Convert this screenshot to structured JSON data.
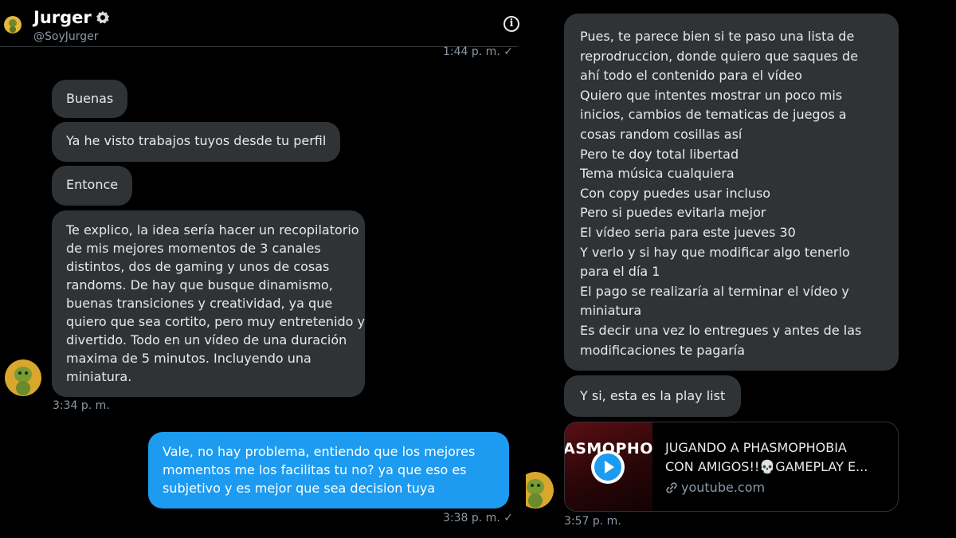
{
  "header": {
    "name": "Jurger",
    "handle": "@SoyJurger",
    "first_stamp": "1:44 p. m.",
    "verified_icon": "verified-badge-icon",
    "info_icon": "info-icon"
  },
  "left_messages": [
    "Buenas",
    "Ya he visto trabajos tuyos desde tu perfil",
    "Entonce"
  ],
  "long_message": [
    "Te explico, la idea sería hacer un recopilatorio",
    "de mis mejores momentos de 3 canales",
    "distintos, dos de gaming y unos de cosas",
    "randoms. De hay que busque dinamismo,",
    "buenas transiciones y creatividad, ya que",
    "quiero que sea cortito, pero muy entretenido y",
    "divertido. Todo en un vídeo de una duración",
    "maxima de 5 minutos. Incluyendo una",
    "miniatura."
  ],
  "incoming_stamp": "3:34 p. m.",
  "outgoing_message": [
    "Vale, no hay problema, entiendo que los mejores",
    "momentos me los facilitas tu no? ya que eso es",
    "subjetivo y es mejor que sea decision tuya"
  ],
  "outgoing_stamp": "3:38 p. m.",
  "check_mark": "✓",
  "right_message": [
    "Pues, te parece bien si te paso una lista de",
    "reprodruccion, donde quiero que saques de",
    "ahí todo el contenido para el vídeo",
    "Quiero que intentes mostrar un poco mis",
    "inicios, cambios de tematicas de juegos a",
    "cosas random cosillas así",
    "Pero te doy total libertad",
    "Tema música cualquiera",
    "Con copy puedes usar incluso",
    "Pero si puedes evitarla mejor",
    "El vídeo seria para este jueves 30",
    "Y verlo y si hay que modificar algo tenerlo",
    "para el día 1",
    "El pago se realizaría al terminar el vídeo y",
    "miniatura",
    "Es decir una vez lo entregues y antes de las",
    "modificaciones te pagaría"
  ],
  "playlist_message": "Y si, esta es la play list",
  "link_card": {
    "thumb_text": "ASMOPHO",
    "title": [
      "JUGANDO A PHASMOPHOBIA",
      "CON AMIGOS!!💀GAMEPLAY E..."
    ],
    "domain": "youtube.com",
    "play_icon": "play-icon",
    "link_icon": "link-icon"
  },
  "right_stamp": "3:57 p. m.",
  "colors": {
    "background": "#000000",
    "incoming_bubble": "#2f3336",
    "outgoing_bubble": "#1d9bf0",
    "muted_text": "#8b98a5"
  }
}
